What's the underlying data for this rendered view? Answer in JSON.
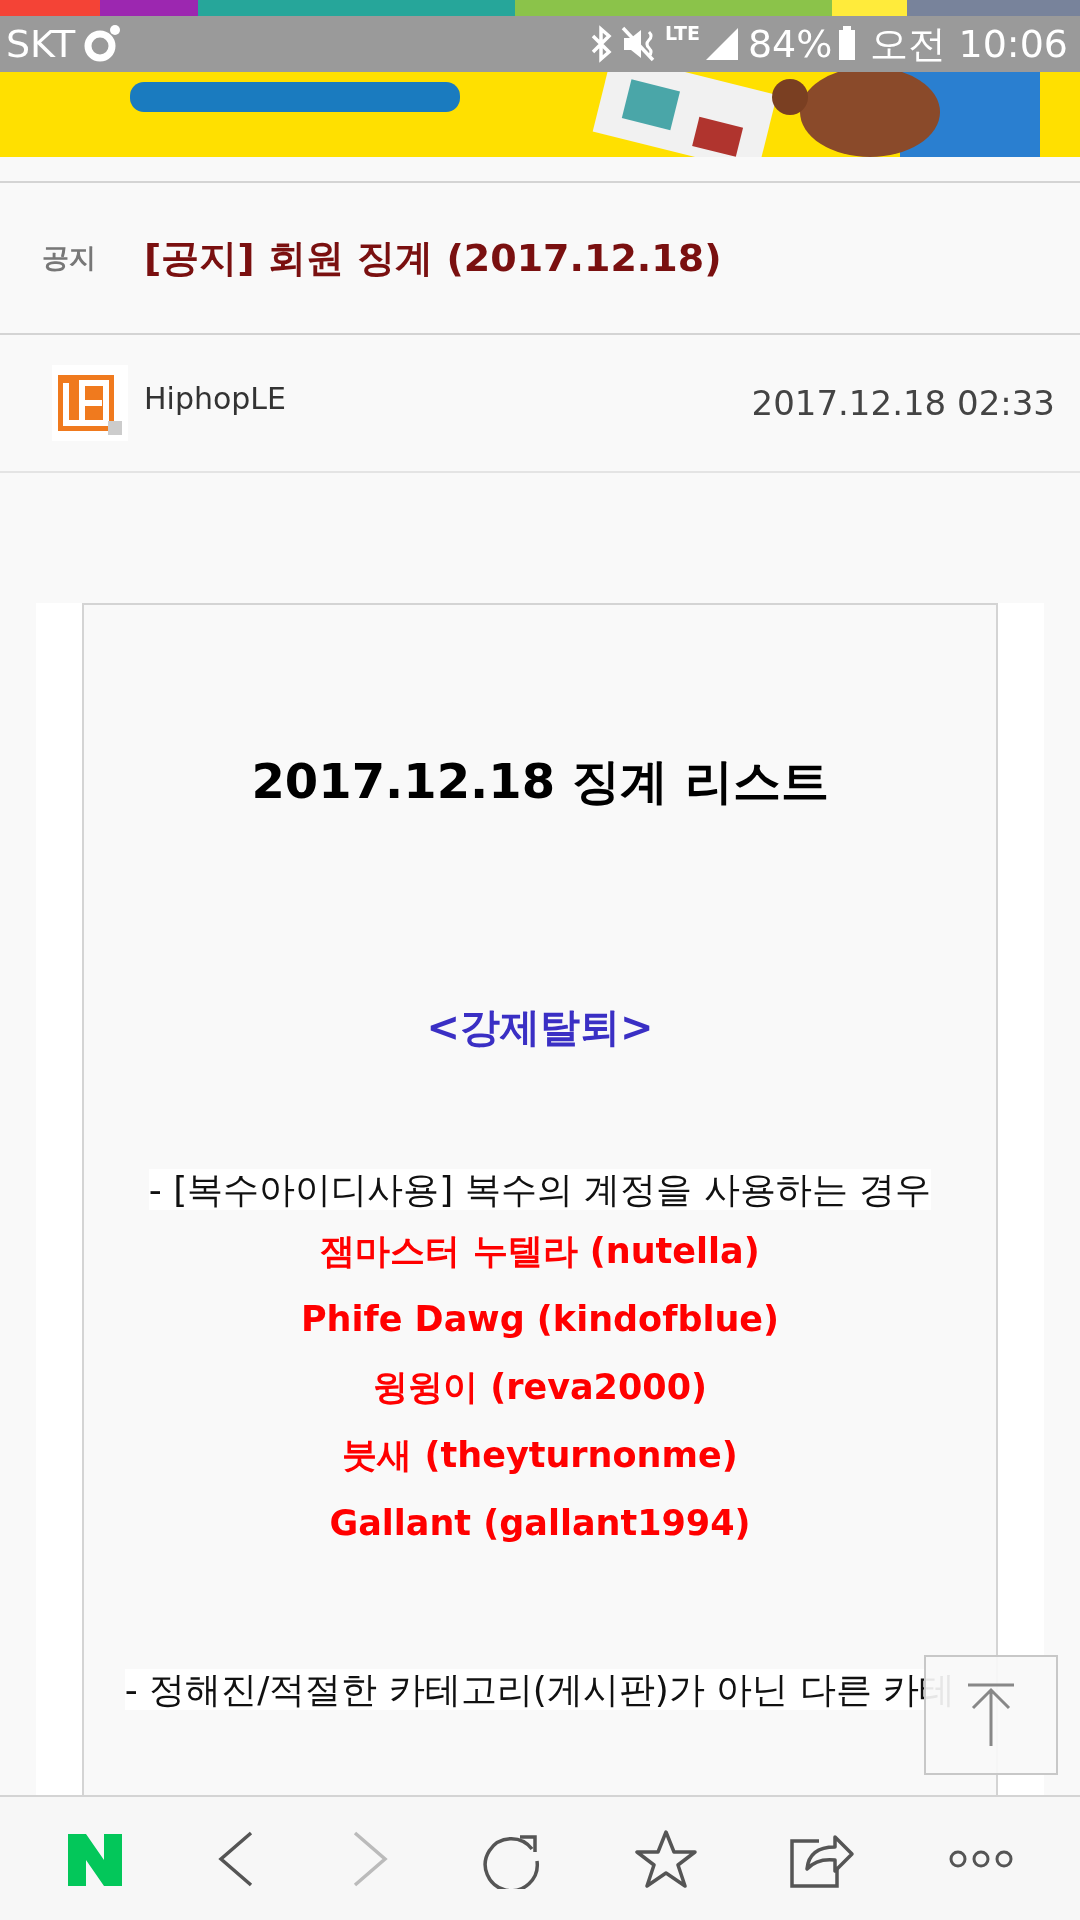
{
  "status_bar": {
    "carrier": "SKT",
    "network": "LTE",
    "battery": "84%",
    "time": "오전 10:06"
  },
  "notice": {
    "tag": "공지",
    "title": "[공지] 회원 징계 (2017.12.18)"
  },
  "author": {
    "name": "HiphopLE",
    "datetime": "2017.12.18 02:33"
  },
  "article": {
    "heading": "2017.12.18 징계 리스트",
    "blocks": [
      {
        "kind": "section_title",
        "text": "<강제탈퇴>"
      },
      {
        "kind": "rule",
        "text": "- [복수아이디사용] 복수의 계정을 사용하는 경우"
      },
      {
        "kind": "member",
        "text": "잼마스터 누텔라 (nutella)"
      },
      {
        "kind": "member",
        "text": "Phife Dawg (kindofblue)"
      },
      {
        "kind": "member",
        "text": "윙윙이 (reva2000)"
      },
      {
        "kind": "member",
        "text": "붓새 (theyturnonme)"
      },
      {
        "kind": "member",
        "text": "Gallant (gallant1994)"
      },
      {
        "kind": "rule",
        "text": "- 정해진/적절한 카테고리(게시판)가 아닌 다른 카테"
      }
    ]
  },
  "bottom_bar": {
    "buttons": [
      {
        "kind": "home"
      },
      {
        "kind": "back",
        "disabled": false
      },
      {
        "kind": "forward",
        "disabled": true
      },
      {
        "kind": "reload"
      },
      {
        "kind": "bookmark"
      },
      {
        "kind": "share"
      },
      {
        "kind": "more"
      }
    ]
  }
}
